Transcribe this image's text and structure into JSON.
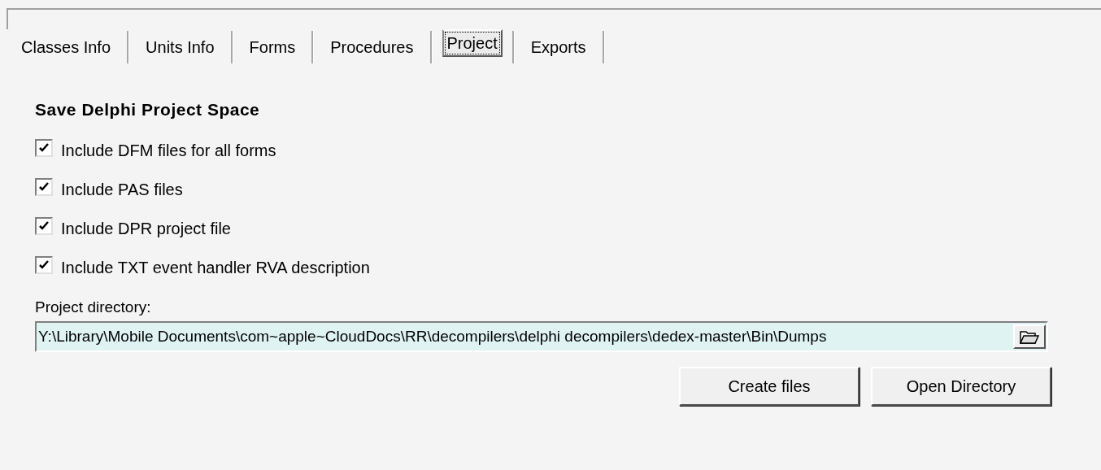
{
  "tabs": [
    {
      "label": "Classes Info",
      "selected": false
    },
    {
      "label": "Units Info",
      "selected": false
    },
    {
      "label": "Forms",
      "selected": false
    },
    {
      "label": "Procedures",
      "selected": false
    },
    {
      "label": "Project",
      "selected": true
    },
    {
      "label": "Exports",
      "selected": false
    }
  ],
  "section_title": "Save Delphi Project Space",
  "options": [
    {
      "label": "Include DFM files for all forms",
      "checked": true
    },
    {
      "label": "Include PAS files",
      "checked": true
    },
    {
      "label": "Include DPR project file",
      "checked": true
    },
    {
      "label": "Include TXT event handler RVA description",
      "checked": true
    }
  ],
  "directory": {
    "label": "Project directory:",
    "value": "Y:\\Library\\Mobile Documents\\com~apple~CloudDocs\\RR\\decompilers\\delphi decompilers\\dedex-master\\Bin\\Dumps"
  },
  "buttons": [
    "Create files",
    "Open Directory"
  ]
}
